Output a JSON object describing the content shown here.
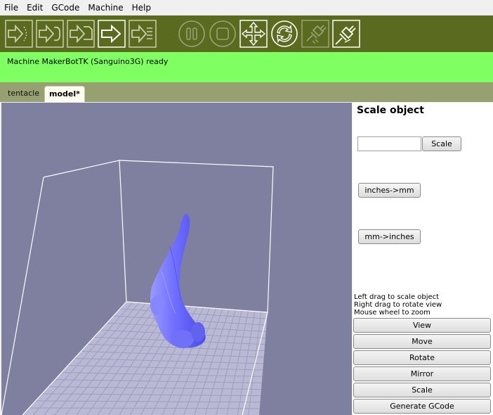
{
  "menu": [
    "File",
    "Edit",
    "GCode",
    "Machine",
    "Help"
  ],
  "toolbar": {
    "buttons": [
      {
        "name": "build-from-sd-icon"
      },
      {
        "name": "build-to-sd-icon"
      },
      {
        "name": "build-to-file-icon"
      },
      {
        "name": "build-icon"
      },
      {
        "name": "upload-icon"
      },
      {
        "name": "pause-icon"
      },
      {
        "name": "stop-icon"
      },
      {
        "name": "control-panel-icon"
      },
      {
        "name": "reset-icon"
      },
      {
        "name": "disconnect-icon"
      },
      {
        "name": "connect-icon"
      }
    ]
  },
  "status": {
    "message": "Machine MakerBotTK (Sanguino3G) ready"
  },
  "tabs": [
    {
      "label": "tentacle",
      "active": false
    },
    {
      "label": "model*",
      "active": true
    }
  ],
  "panel": {
    "title": "Scale object",
    "scale_input": {
      "value": "",
      "placeholder": ""
    },
    "scale_label": "Scale",
    "inches_to_mm_label": "inches->mm",
    "mm_to_inches_label": "mm->inches",
    "help": [
      "Left drag to scale object",
      "Right drag to rotate view",
      "Mouse wheel to zoom"
    ],
    "modes": [
      "View",
      "Move",
      "Rotate",
      "Mirror",
      "Scale",
      "Generate GCode"
    ]
  },
  "colors": {
    "toolbar_bg": "#5a6b20",
    "status_bg": "#80ff62",
    "tabbar_bg": "#96a070",
    "viewport_bg": "#7f7f9f",
    "model_color": "#6b6bff"
  }
}
